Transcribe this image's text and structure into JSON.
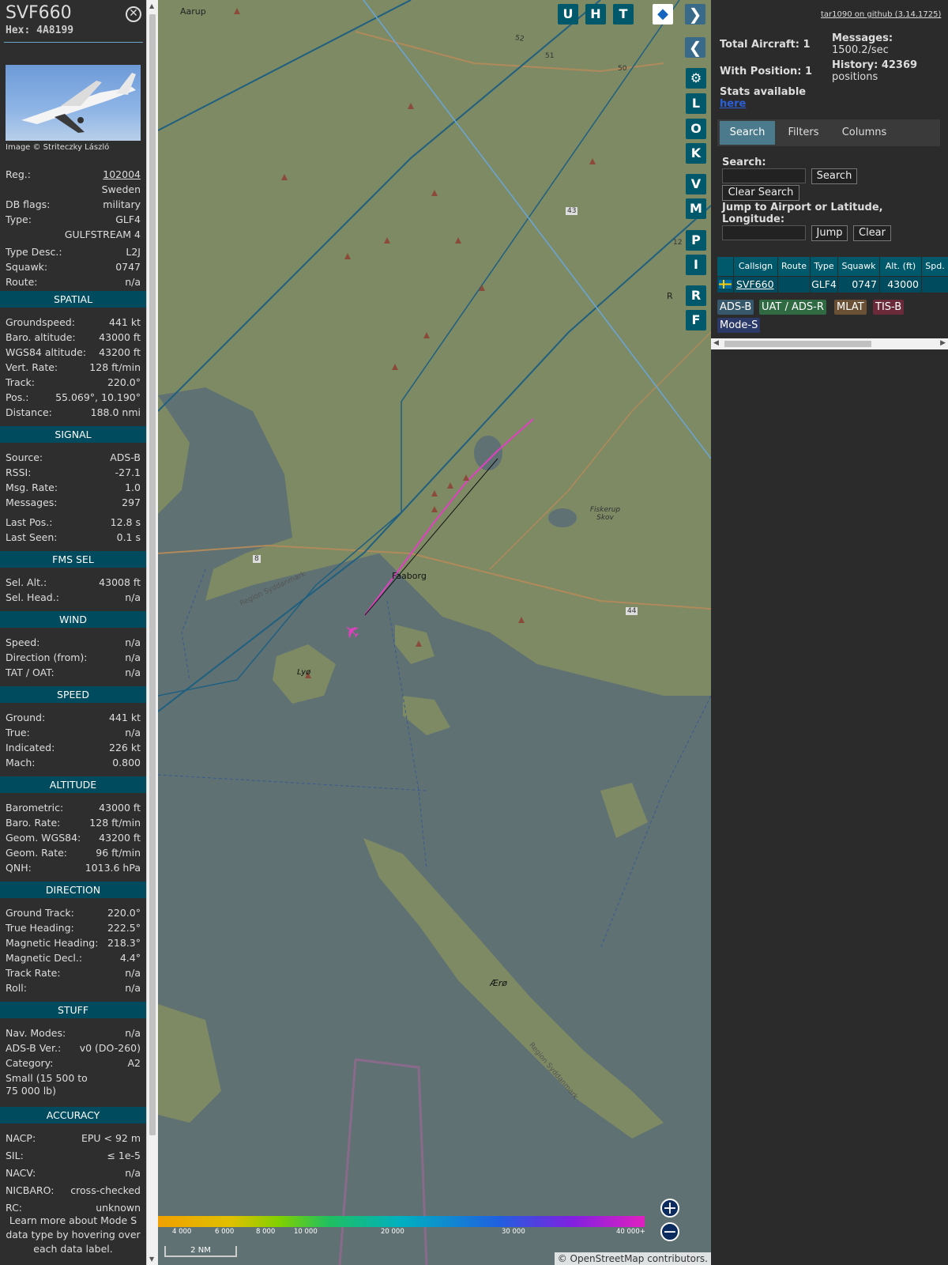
{
  "aircraft": {
    "callsign": "SVF660",
    "hex_label": "Hex: 4A8199",
    "photo_credit": "Image © Striteczky László",
    "info": [
      {
        "label": "Reg.:",
        "value": "102004",
        "link": true
      },
      {
        "label": "",
        "value": "Sweden"
      },
      {
        "label": "DB flags:",
        "value": "military"
      },
      {
        "label": "Type:",
        "value": "GLF4"
      },
      {
        "label": "",
        "value": "GULFSTREAM 4"
      },
      {
        "label": "Type Desc.:",
        "value": "L2J"
      },
      {
        "label": "Squawk:",
        "value": "0747"
      },
      {
        "label": "Route:",
        "value": "n/a"
      }
    ]
  },
  "sections": [
    {
      "title": "SPATIAL",
      "rows": [
        {
          "label": "Groundspeed:",
          "value": "441 kt"
        },
        {
          "label": "Baro. altitude:",
          "value": "43000 ft"
        },
        {
          "label": "WGS84 altitude:",
          "value": "43200 ft"
        },
        {
          "label": "Vert. Rate:",
          "value": "128 ft/min"
        },
        {
          "label": "Track:",
          "value": "220.0°"
        },
        {
          "label": "Pos.:",
          "value": "55.069°, 10.190°"
        },
        {
          "label": "Distance:",
          "value": "188.0 nmi"
        }
      ]
    },
    {
      "title": "SIGNAL",
      "rows": [
        {
          "label": "Source:",
          "value": "ADS-B"
        },
        {
          "label": "RSSI:",
          "value": "-27.1"
        },
        {
          "label": "Msg. Rate:",
          "value": "1.0"
        },
        {
          "label": "Messages:",
          "value": "297"
        },
        {
          "label": "Last Pos.:",
          "value": "12.8 s"
        },
        {
          "label": "Last Seen:",
          "value": "0.1 s"
        }
      ]
    },
    {
      "title": "FMS SEL",
      "rows": [
        {
          "label": "Sel. Alt.:",
          "value": "43008 ft"
        },
        {
          "label": "Sel. Head.:",
          "value": "n/a"
        }
      ]
    },
    {
      "title": "WIND",
      "rows": [
        {
          "label": "Speed:",
          "value": "n/a"
        },
        {
          "label": "Direction (from):",
          "value": "n/a"
        },
        {
          "label": "TAT / OAT:",
          "value": "n/a"
        }
      ]
    },
    {
      "title": "SPEED",
      "rows": [
        {
          "label": "Ground:",
          "value": "441 kt"
        },
        {
          "label": "True:",
          "value": "n/a"
        },
        {
          "label": "Indicated:",
          "value": "226 kt"
        },
        {
          "label": "Mach:",
          "value": "0.800"
        }
      ]
    },
    {
      "title": "ALTITUDE",
      "rows": [
        {
          "label": "Barometric:",
          "value": "43000 ft"
        },
        {
          "label": "Baro. Rate:",
          "value": "128 ft/min"
        },
        {
          "label": "Geom. WGS84:",
          "value": "43200 ft"
        },
        {
          "label": "Geom. Rate:",
          "value": "96 ft/min"
        },
        {
          "label": "QNH:",
          "value": "1013.6 hPa"
        }
      ]
    },
    {
      "title": "DIRECTION",
      "rows": [
        {
          "label": "Ground Track:",
          "value": "220.0°"
        },
        {
          "label": "True Heading:",
          "value": "222.5°"
        },
        {
          "label": "Magnetic Heading:",
          "value": "218.3°"
        },
        {
          "label": "Magnetic Decl.:",
          "value": "4.4°"
        },
        {
          "label": "Track Rate:",
          "value": "n/a"
        },
        {
          "label": "Roll:",
          "value": "n/a"
        }
      ]
    },
    {
      "title": "STUFF",
      "rows": [
        {
          "label": "Nav. Modes:",
          "value": "n/a"
        },
        {
          "label": "ADS-B Ver.:",
          "value": "v0 (DO-260)"
        },
        {
          "label": "Category:",
          "value": "A2"
        },
        {
          "label": "Small (15 500 to 75 000 lb)",
          "value": ""
        }
      ]
    },
    {
      "title": "ACCURACY",
      "rows": [
        {
          "label": "NACP:",
          "value": "EPU < 92 m"
        },
        {
          "label": "SIL:",
          "value": "≤ 1e-5"
        },
        {
          "label": "NACV:",
          "value": "n/a"
        },
        {
          "label": "NICBARO:",
          "value": "cross-checked"
        },
        {
          "label": "RC:",
          "value": "unknown"
        }
      ]
    }
  ],
  "learn_more": "Learn more about Mode S data type by hovering over each data label.",
  "map": {
    "buttons_top": [
      "U",
      "H",
      "T"
    ],
    "buttons_side": [
      "L",
      "O",
      "K",
      "V",
      "M",
      "P",
      "I",
      "R",
      "F"
    ],
    "place_labels": [
      "Aarup",
      "Faaborg",
      "Lyø",
      "Ærø",
      "Fiskerup Skov",
      "Region Syddanmark",
      "Region Syddanmark",
      "R"
    ],
    "road_labels": [
      "52",
      "51",
      "50",
      "43",
      "44",
      "8",
      "12"
    ],
    "scale_label": "2 NM",
    "attribution": "© OpenStreetMap contributors.",
    "altitude_scale": [
      "4 000",
      "6 000",
      "8 000",
      "10 000",
      "20 000",
      "30 000",
      "40 000+"
    ]
  },
  "right": {
    "github": "tar1090 on github (3.14.1725)",
    "total_aircraft": "Total Aircraft: 1",
    "with_position": "With Position: 1",
    "messages_label": "Messages:",
    "messages_value": "1500.2/sec",
    "history_label": "History: 42369",
    "history_value": "positions",
    "stats_text": "Stats available",
    "stats_link": "here",
    "tabs": [
      "Search",
      "Filters",
      "Columns"
    ],
    "search_label": "Search:",
    "search_button": "Search",
    "clear_search_button": "Clear Search",
    "jump_label": "Jump to Airport or Latitude, Longitude:",
    "jump_button": "Jump",
    "clear_button": "Clear",
    "table_headers": [
      "Callsign",
      "Route",
      "Type",
      "Squawk",
      "Alt. (ft)",
      "Spd."
    ],
    "table_row": {
      "callsign": "SVF660",
      "route": "",
      "type": "GLF4",
      "squawk": "0747",
      "alt": "43000"
    },
    "badges": [
      "ADS-B",
      "UAT / ADS-R",
      "MLAT",
      "TIS-B",
      "Mode-S"
    ]
  },
  "colors": {
    "section_bg": "#004b5e",
    "accent": "#00596b",
    "track": "#e040c0"
  }
}
